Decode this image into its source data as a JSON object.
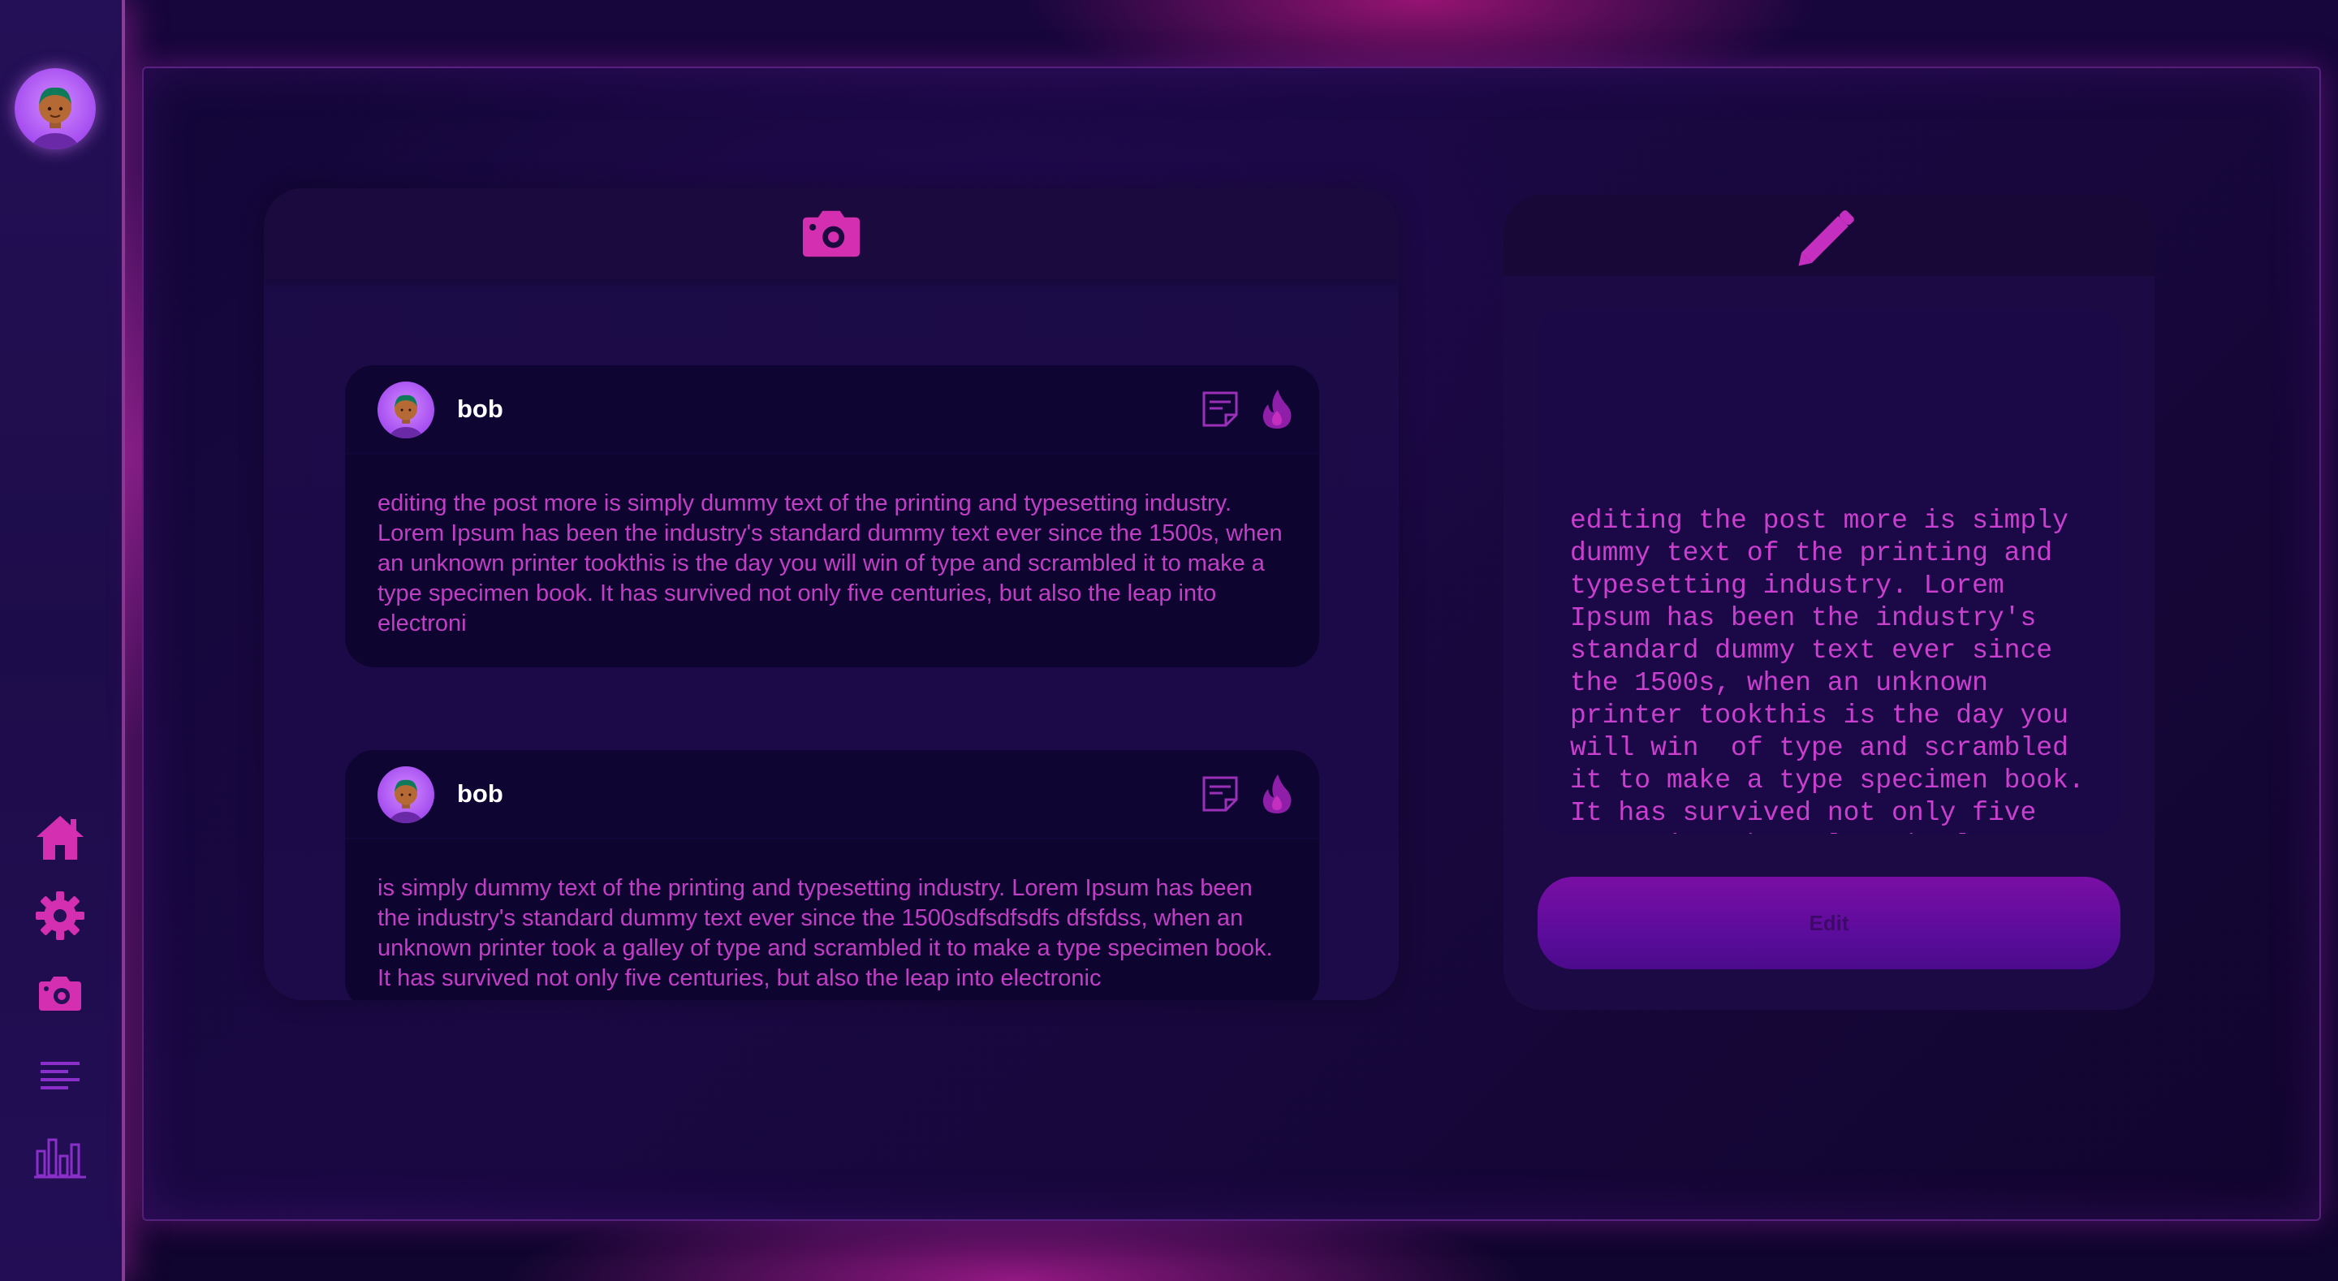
{
  "sidebar": {
    "avatar_icon": "user-avatar",
    "nav_items": [
      {
        "name": "home",
        "icon": "home-icon"
      },
      {
        "name": "settings",
        "icon": "gear-icon"
      },
      {
        "name": "camera",
        "icon": "camera-icon"
      },
      {
        "name": "posts",
        "icon": "text-lines-icon"
      },
      {
        "name": "stats",
        "icon": "bar-chart-icon"
      }
    ]
  },
  "feed": {
    "header_icon": "camera-icon",
    "posts": [
      {
        "author": "bob",
        "body": "editing the post more is simply dummy text of the printing and typesetting industry. Lorem Ipsum has been the industry's standard dummy text ever since the 1500s, when an unknown printer tookthis is the day you will win of type and scrambled it to make a type specimen book. It has survived not only five centuries, but also the leap into electroni"
      },
      {
        "author": "bob",
        "body": "is simply dummy text of the printing and typesetting industry. Lorem Ipsum has been the industry's standard dummy text ever since the 1500sdfsdfsdfs dfsfdss, when an unknown printer took a galley of type and scrambled it to make a type specimen book. It has survived not only five centuries, but also the leap into electronic"
      }
    ]
  },
  "editor": {
    "header_icon": "pencil-icon",
    "text": "editing the post more is simply dummy text of the printing and typesetting industry. Lorem Ipsum has been the industry's standard dummy text ever since the 1500s, when an unknown printer tookthis is the day you will win  of type and scrambled it to make a type specimen book. It has survived not only five centuries, but also the leap into electroni",
    "button_label": "Edit"
  },
  "colors": {
    "accent": "#c13fc4",
    "icon_pink": "#d42fb0",
    "icon_purple": "#8a2fc9",
    "background": "#12052f"
  }
}
